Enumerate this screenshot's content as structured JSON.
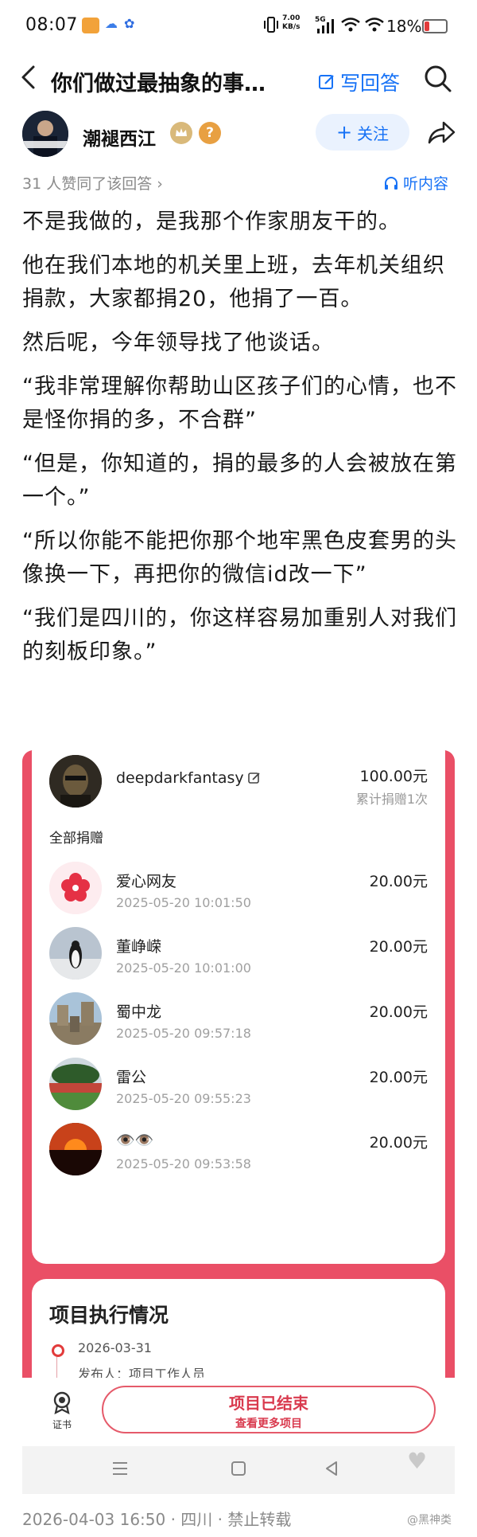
{
  "status": {
    "time": "08:07",
    "net_speed": "7.00",
    "net_unit": "KB/s",
    "signal": "5G",
    "battery": "18%"
  },
  "topbar": {
    "title": "你们做过最抽象的事…",
    "write_label": "写回答"
  },
  "author": {
    "name": "潮褪西江",
    "follow_label": "关注",
    "badge_q": "?"
  },
  "meta": {
    "likes": "31 人赞同了该回答 ›",
    "listen_label": "听内容"
  },
  "answer": {
    "paragraphs": [
      "不是我做的，是我那个作家朋友干的。",
      "他在我们本地的机关里上班，去年机关组织捐款，大家都捐20，他捐了一百。",
      "然后呢，今年领导找了他谈话。",
      "“我非常理解你帮助山区孩子们的心情，也不是怪你捐的多，不合群”",
      "“但是，你知道的，捐的最多的人会被放在第一个。”",
      "“所以你能不能把你那个地牢黑色皮套男的头像换一下，再把你的微信id改一下”",
      "“我们是四川的，你这样容易加重别人对我们的刻板印象。”"
    ]
  },
  "donation_card": {
    "top": {
      "name": "deepdarkfantasy",
      "amount": "100.00元",
      "count": "累计捐赠1次"
    },
    "all_label": "全部捐赠",
    "donors": [
      {
        "name": "爱心网友",
        "time": "2025-05-20 10:01:50",
        "amount": "20.00元"
      },
      {
        "name": "董峥嵘",
        "time": "2025-05-20 10:01:00",
        "amount": "20.00元"
      },
      {
        "name": "蜀中龙",
        "time": "2025-05-20 09:57:18",
        "amount": "20.00元"
      },
      {
        "name": "雷公",
        "time": "2025-05-20 09:55:23",
        "amount": "20.00元"
      },
      {
        "name": "👁️👁️",
        "time": "2025-05-20 09:53:58",
        "amount": "20.00元"
      }
    ],
    "exec": {
      "title": "项目执行情况",
      "date": "2026-03-31",
      "publisher": "发布人：项目工作人员"
    }
  },
  "bottombar": {
    "cert_label": "证书",
    "ended_label": "项目已结束",
    "more_label": "查看更多项目"
  },
  "footer": {
    "text": "2026-04-03 16:50 · 四川 · 禁止转载",
    "watermark": "@黑神类"
  },
  "colors": {
    "accent": "#1772f6",
    "card": "#ea4f66"
  }
}
